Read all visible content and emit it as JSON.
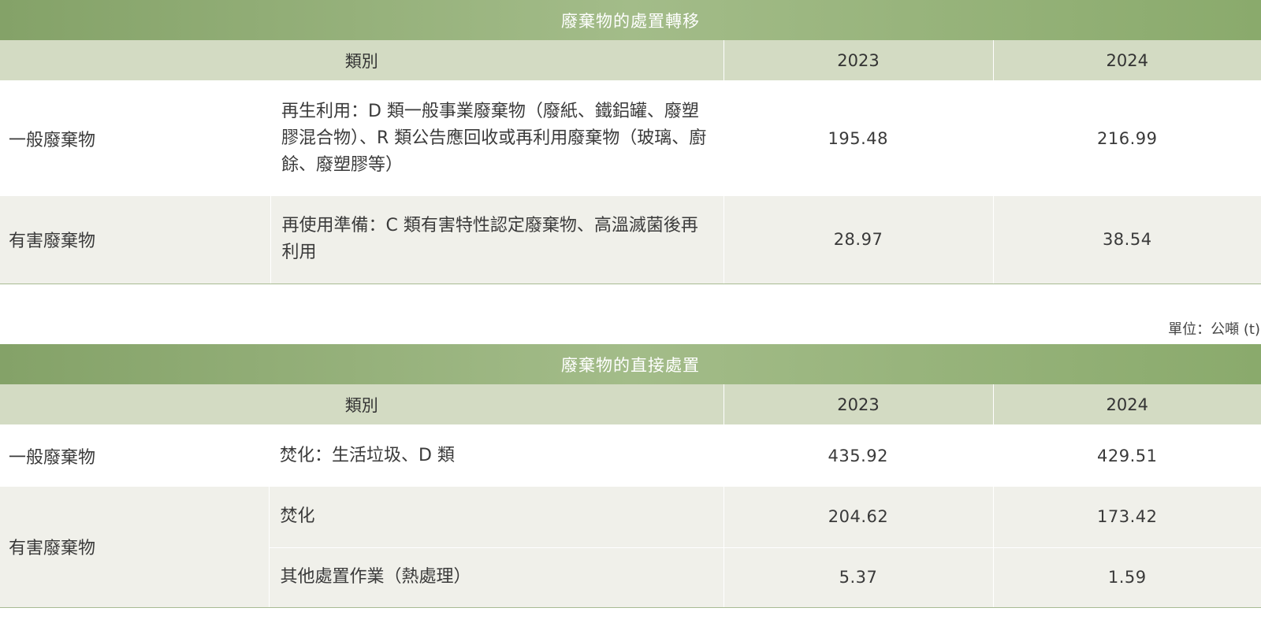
{
  "transfer_table": {
    "title": "廢棄物的處置轉移",
    "headers": {
      "category": "類別",
      "y2023": "2023",
      "y2024": "2024"
    },
    "rows": [
      {
        "category": "一般廢棄物",
        "description": "再生利用：D 類一般事業廢棄物（廢紙、鐵鋁罐、廢塑膠混合物）、R 類公告應回收或再利用廢棄物（玻璃、廚餘、廢塑膠等）",
        "y2023": "195.48",
        "y2024": "216.99"
      },
      {
        "category": "有害廢棄物",
        "description": "再使用準備：C 類有害特性認定廢棄物、高溫滅菌後再利用",
        "y2023": "28.97",
        "y2024": "38.54"
      }
    ]
  },
  "unit_note": "單位：公噸 (t)",
  "direct_table": {
    "title": "廢棄物的直接處置",
    "headers": {
      "category": "類別",
      "y2023": "2023",
      "y2024": "2024"
    },
    "rows": [
      {
        "category": "一般廢棄物",
        "description": "焚化：生活垃圾、D 類",
        "y2023": "435.92",
        "y2024": "429.51"
      },
      {
        "category": "有害廢棄物",
        "description": "焚化",
        "y2023": "204.62",
        "y2024": "173.42"
      },
      {
        "category": "",
        "description": "其他處置作業（熱處理）",
        "y2023": "5.37",
        "y2024": "1.59"
      }
    ]
  }
}
